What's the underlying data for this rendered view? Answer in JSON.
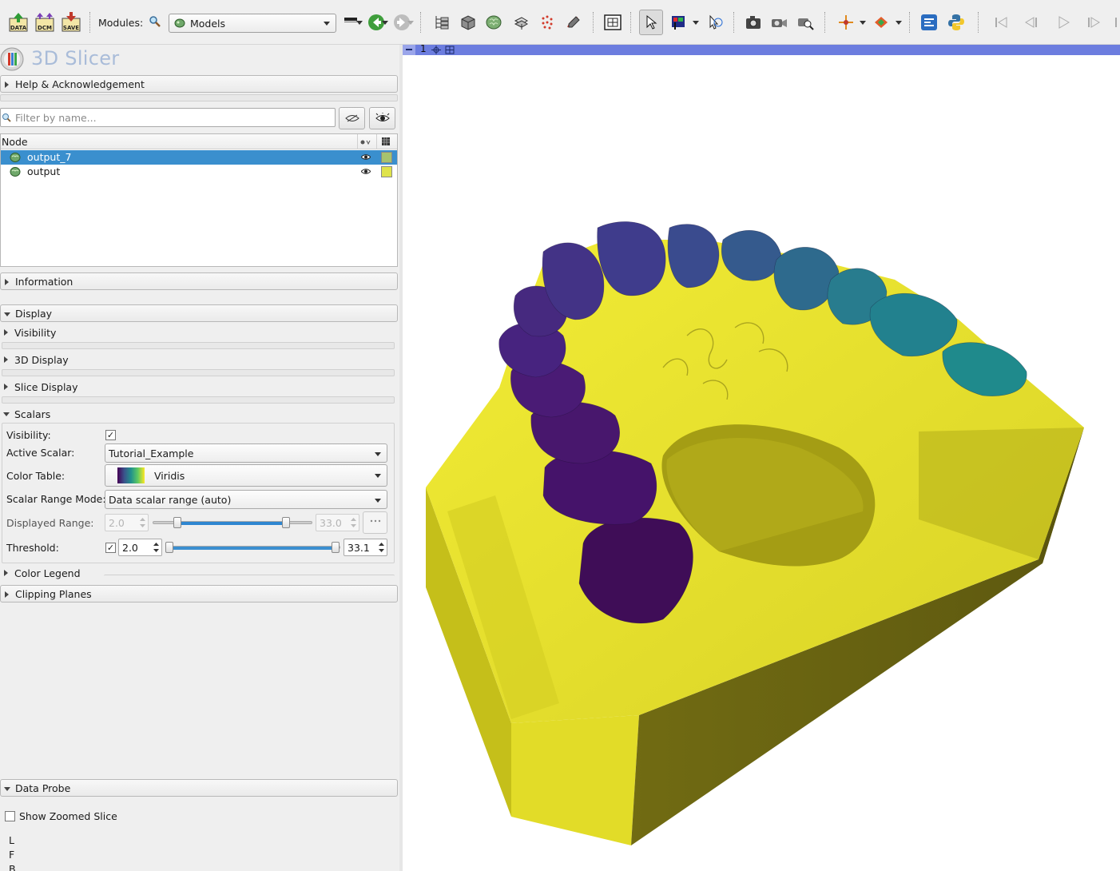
{
  "toolbar": {
    "modules_label": "Modules:",
    "module_selected": "Models",
    "buttons": {
      "data": "DATA",
      "dcm": "DCM",
      "save": "SAVE"
    }
  },
  "app": {
    "title": "3D Slicer"
  },
  "sections": {
    "help": "Help & Acknowledgement",
    "information": "Information",
    "display": "Display",
    "visibility": "Visibility",
    "display3d": "3D Display",
    "slice_display": "Slice Display",
    "scalars": "Scalars",
    "color_legend": "Color Legend",
    "clipping_planes": "Clipping Planes",
    "data_probe": "Data Probe"
  },
  "filter": {
    "placeholder": "Filter by name..."
  },
  "tree": {
    "header": "Node",
    "rows": [
      {
        "name": "output_7",
        "selected": true,
        "color": "#a7c36e"
      },
      {
        "name": "output",
        "selected": false,
        "color": "#dfe34b"
      }
    ]
  },
  "scalars": {
    "visibility_label": "Visibility:",
    "visibility_checked": true,
    "active_scalar_label": "Active Scalar:",
    "active_scalar": "Tutorial_Example",
    "color_table_label": "Color Table:",
    "color_table": "Viridis",
    "range_mode_label": "Scalar Range Mode:",
    "range_mode": "Data scalar range (auto)",
    "displayed_range_label": "Displayed Range:",
    "displayed_min": "2.0",
    "displayed_max": "33.0",
    "threshold_label": "Threshold:",
    "threshold_checked": true,
    "threshold_min": "2.0",
    "threshold_max": "33.1"
  },
  "data_probe": {
    "show_zoomed_slice": "Show Zoomed Slice",
    "coords": [
      "L",
      "F",
      "B"
    ]
  },
  "view": {
    "number": "1"
  },
  "colors": {
    "selection": "#3a8fce",
    "view_bar": "#6c7ddf",
    "model_base": "#e3dd2a",
    "model_shadow": "#6f6a13"
  }
}
